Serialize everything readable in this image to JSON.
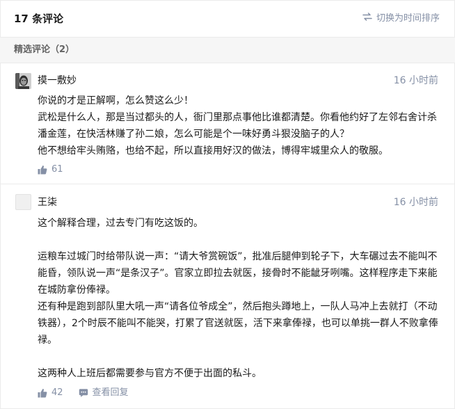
{
  "header": {
    "title": "17 条评论",
    "sort_label": "切换为时间排序"
  },
  "section": {
    "label": "精选评论（2）"
  },
  "comments": [
    {
      "author": "摸一敷妙",
      "time": "16 小时前",
      "lines": [
        "你说的才是正解啊，怎么赞这么少！",
        "武松是什么人，那是当过都头的人，衙门里那点事他比谁都清楚。你看他约好了左邻右舍计杀潘金莲，在快活林赚了孙二娘，怎么可能是个一味好勇斗狠没脑子的人？",
        "他不想给牢头贿赂，也给不起，所以直接用好汉的做法，博得牢城里众人的敬服。"
      ],
      "likes": "61"
    },
    {
      "author": "王柒",
      "time": "16 小时前",
      "lines": [
        "这个解释合理，过去专门有吃这饭的。",
        "",
        "运粮车过城门时给带队说一声：“请大爷赏碗饭”，批准后腿伸到轮子下，大车碾过去不能叫不能昏，领队说一声“是条汉子”。官家立即拉去就医，接骨时不能龇牙咧嘴。这样程序走下来能在城防拿份俸禄。",
        "还有种是跑到部队里大吼一声“请各位爷成全”，然后抱头蹲地上，一队人马冲上去就打（不动铁器），2个时辰不能叫不能哭，打累了官送就医，活下来拿俸禄，也可以单挑一群人不败拿俸禄。",
        "",
        "这两种人上班后都需要参与官方不便于出面的私斗。"
      ],
      "likes": "42",
      "reply_label": "查看回复"
    }
  ]
}
